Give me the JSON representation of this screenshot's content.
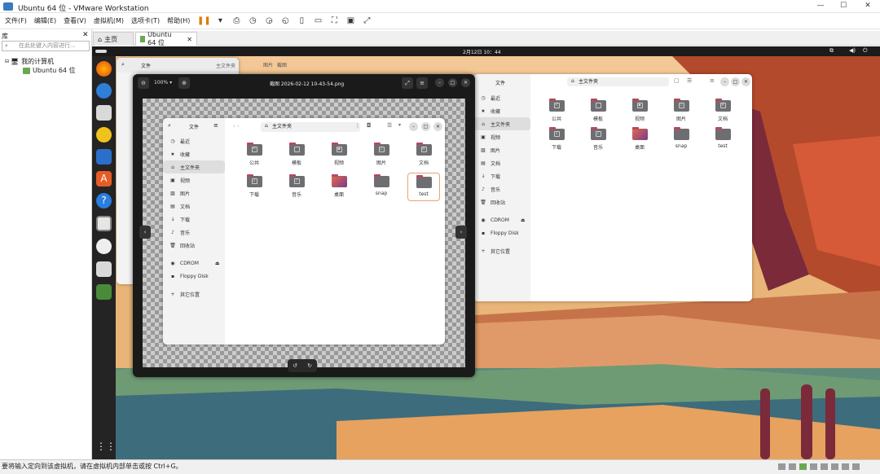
{
  "window": {
    "title": "Ubuntu 64 位 - VMware Workstation",
    "minimize": "—",
    "maximize": "☐",
    "close": "✕"
  },
  "menu": [
    "文件(F)",
    "编辑(E)",
    "查看(V)",
    "虚拟机(M)",
    "选项卡(T)",
    "帮助(H)"
  ],
  "library": {
    "header": "库",
    "close": "✕",
    "search_placeholder": "在此处键入内容进行...",
    "tree_root": "我的计算机",
    "tree_vm": "Ubuntu 64 位"
  },
  "tabs": [
    {
      "label": "主页"
    },
    {
      "label": "Ubuntu 64 位"
    }
  ],
  "statusbar": {
    "text": "要将输入定向到该虚拟机，请在虚拟机内部单击或按 Ctrl+G。"
  },
  "ubuntu": {
    "clock": "2月12日 10：44"
  },
  "viewer": {
    "title": "截图 2026-02-12 10-43-54.png",
    "zoom": "100%"
  },
  "files": {
    "app_title": "文件",
    "path": "主文件夹",
    "sidebar": [
      "最近",
      "收藏",
      "主文件夹",
      "视频",
      "图片",
      "文档",
      "下载",
      "音乐",
      "回收站"
    ],
    "devices": [
      "CDROM",
      "Floppy Disk"
    ],
    "other": "其它位置",
    "folders": [
      "公共",
      "模板",
      "视频",
      "图片",
      "文档",
      "下载",
      "音乐",
      "桌面",
      "snap",
      "test"
    ]
  },
  "bgwin": {
    "path1": "主文件夹",
    "path2": "图片",
    "path3": "截图"
  }
}
